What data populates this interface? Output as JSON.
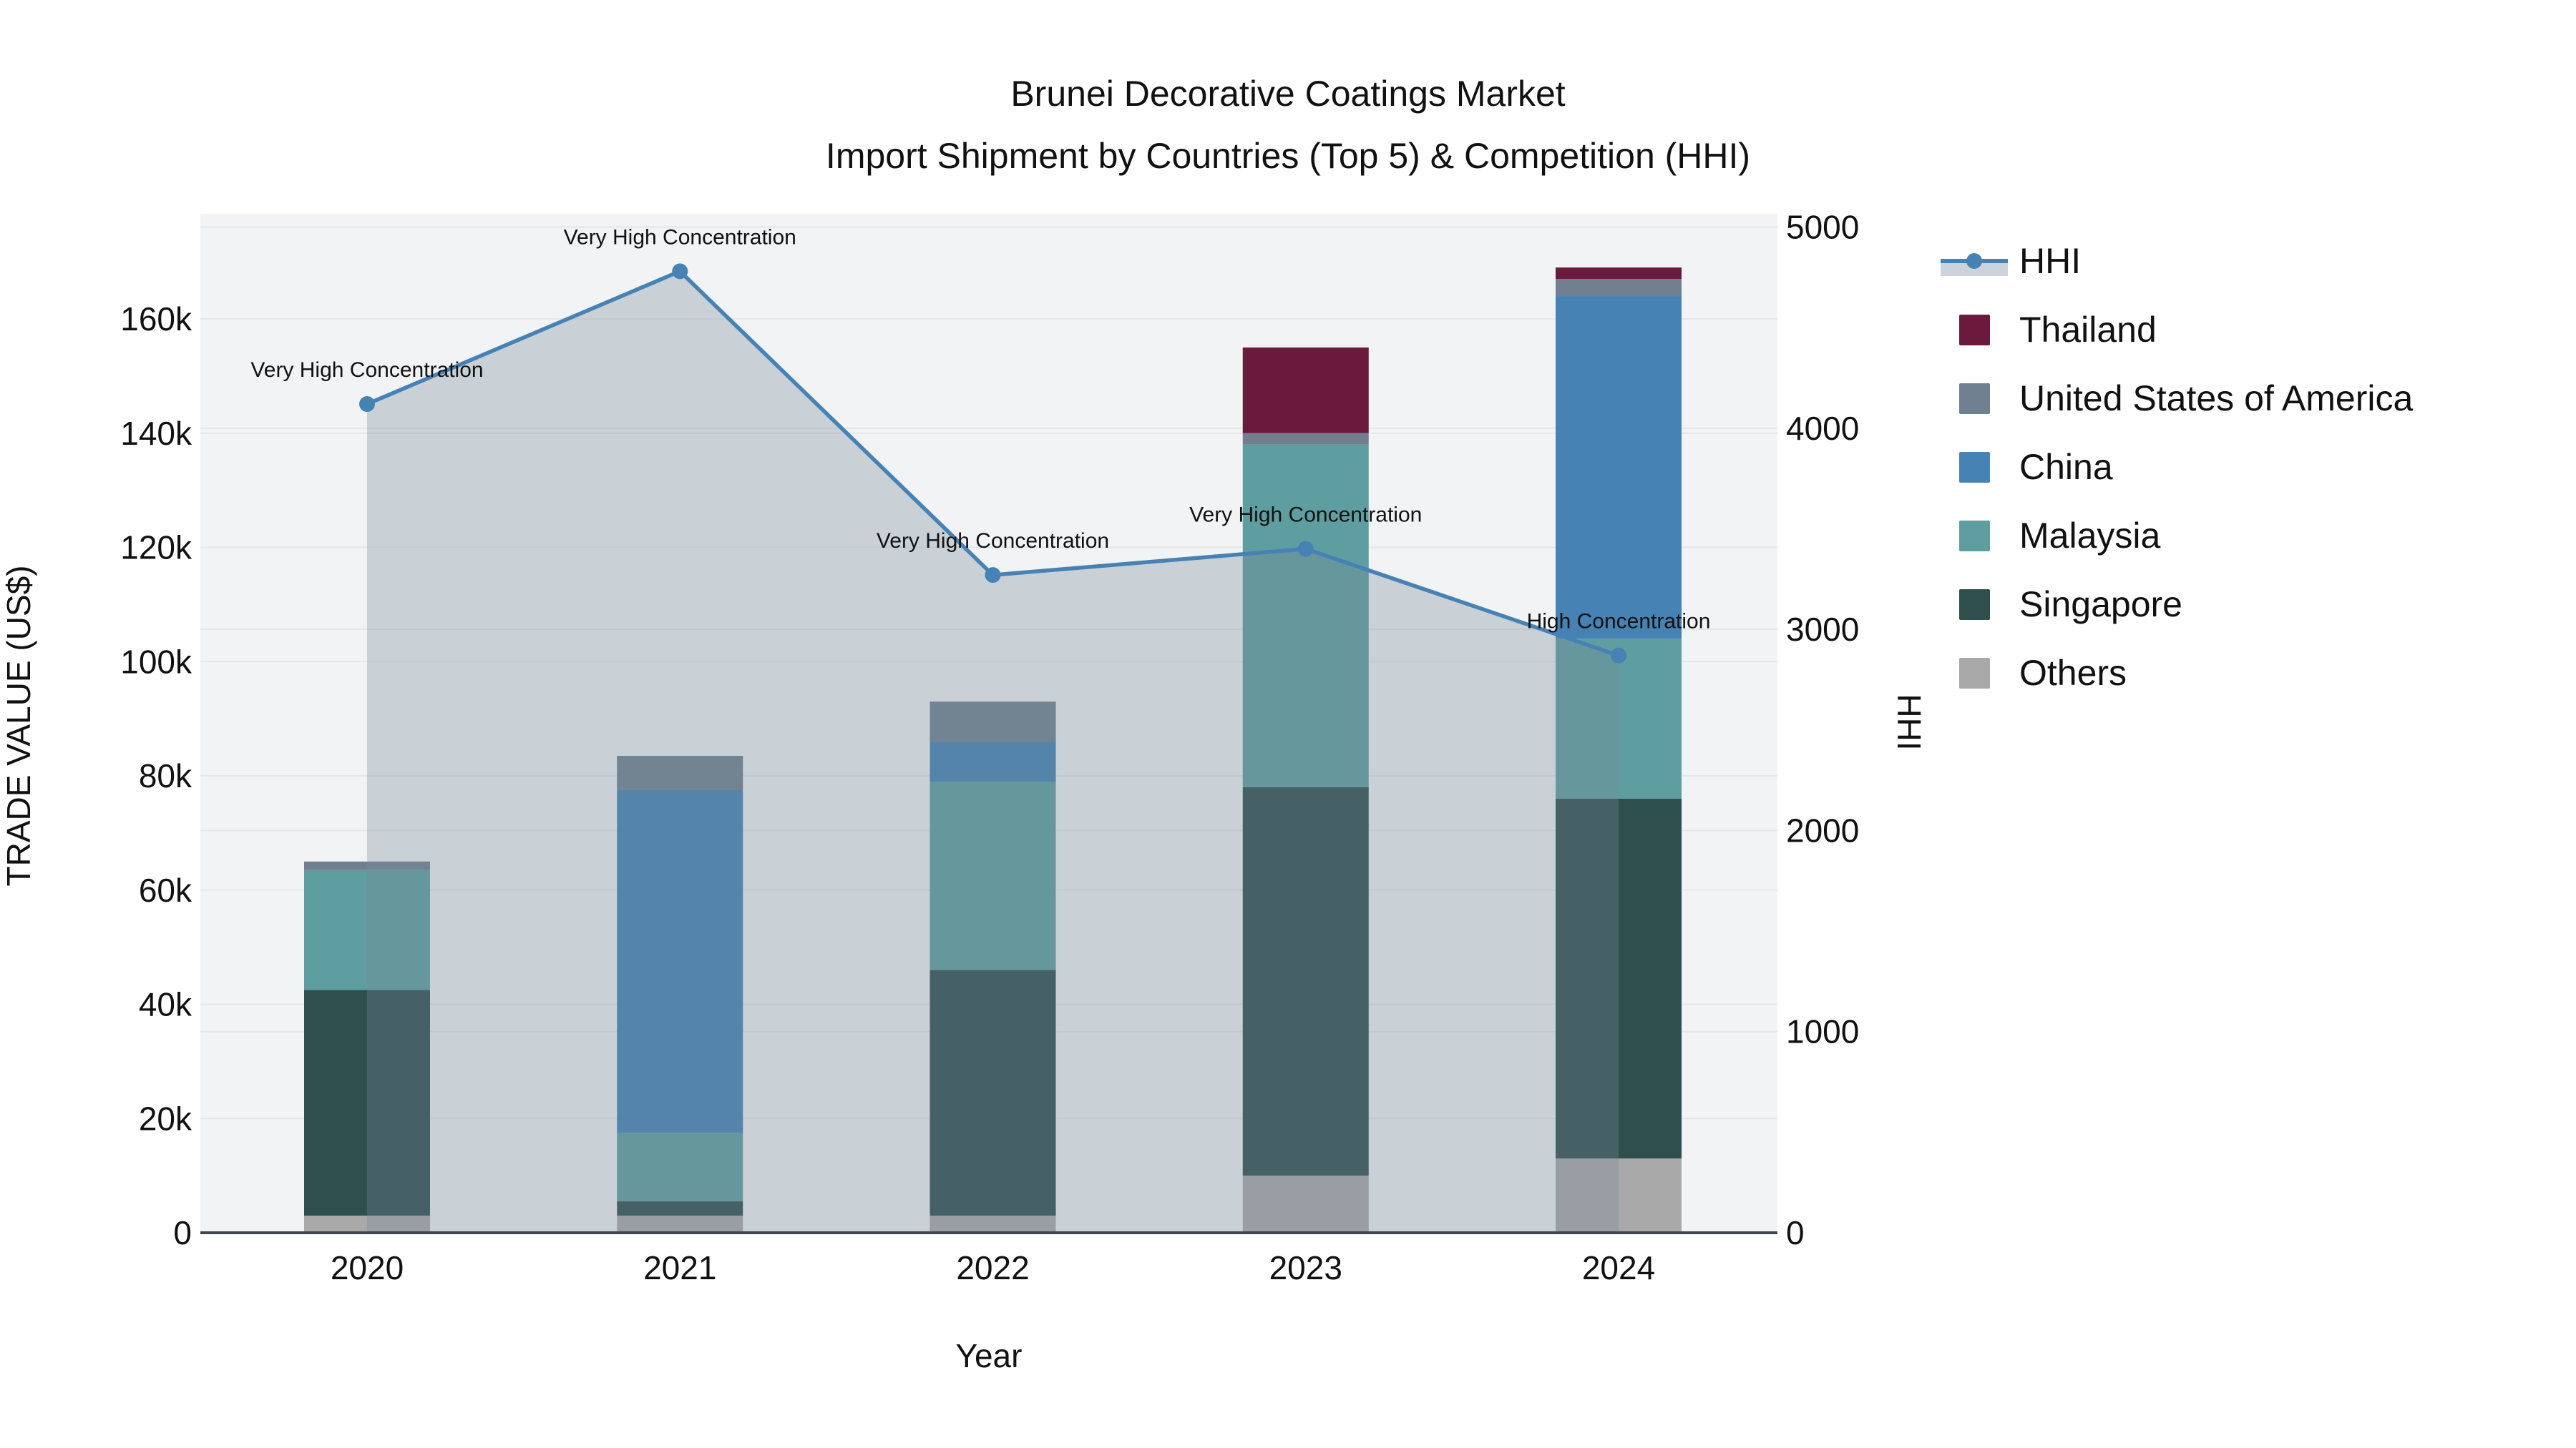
{
  "title": {
    "line1": "Brunei Decorative Coatings Market",
    "line2": "Import Shipment by Countries (Top 5) & Competition (HHI)"
  },
  "axes": {
    "x": {
      "title": "Year"
    },
    "y_left": {
      "title": "TRADE VALUE (US$)",
      "tick_labels": [
        "0",
        "20k",
        "40k",
        "60k",
        "80k",
        "100k",
        "120k",
        "140k",
        "160k"
      ],
      "tick_values": [
        0,
        20000,
        40000,
        60000,
        80000,
        100000,
        120000,
        140000,
        160000
      ]
    },
    "y_right": {
      "title": "HHI",
      "tick_labels": [
        "0",
        "1000",
        "2000",
        "3000",
        "4000",
        "5000"
      ],
      "tick_values": [
        0,
        1000,
        2000,
        3000,
        4000,
        5000
      ]
    }
  },
  "legend": {
    "items": [
      {
        "label": "HHI",
        "type": "line",
        "color": "#4682B4"
      },
      {
        "label": "Thailand",
        "type": "bar",
        "color": "#6A1B3D"
      },
      {
        "label": "United States of America",
        "type": "bar",
        "color": "#708090"
      },
      {
        "label": "China",
        "type": "bar",
        "color": "#4682B4"
      },
      {
        "label": "Malaysia",
        "type": "bar",
        "color": "#5F9EA0"
      },
      {
        "label": "Singapore",
        "type": "bar",
        "color": "#2F4F4F"
      },
      {
        "label": "Others",
        "type": "bar",
        "color": "#A9A9A9"
      }
    ]
  },
  "chart_data": {
    "type": "combo-stacked-bar-plus-line-area",
    "title": "Brunei Decorative Coatings Market Import Shipment by Countries (Top 5) & Competition (HHI)",
    "xlabel": "Year",
    "ylabel_left": "TRADE VALUE (US$)",
    "ylabel_right": "HHI",
    "ylim_left": [
      0,
      178000
    ],
    "ylim_right": [
      0,
      5000
    ],
    "grid": true,
    "legend_position": "right",
    "categories": [
      "2020",
      "2021",
      "2022",
      "2023",
      "2024"
    ],
    "bar_stack_order_bottom_to_top": [
      "Others",
      "Singapore",
      "Malaysia",
      "China",
      "United States of America",
      "Thailand"
    ],
    "series": [
      {
        "name": "Others",
        "color": "#A9A9A9",
        "values": [
          3000,
          3000,
          3000,
          10000,
          13000
        ]
      },
      {
        "name": "Singapore",
        "color": "#2F4F4F",
        "values": [
          39500,
          2500,
          43000,
          68000,
          63000
        ]
      },
      {
        "name": "Malaysia",
        "color": "#5F9EA0",
        "values": [
          21000,
          12000,
          33000,
          60000,
          28000
        ]
      },
      {
        "name": "China",
        "color": "#4682B4",
        "values": [
          0,
          60000,
          7000,
          0,
          60000
        ]
      },
      {
        "name": "United States of America",
        "color": "#708090",
        "values": [
          1500,
          6000,
          7000,
          2000,
          3000
        ]
      },
      {
        "name": "Thailand",
        "color": "#6A1B3D",
        "values": [
          0,
          0,
          0,
          15000,
          2000
        ]
      }
    ],
    "bar_totals": [
      65000,
      83500,
      93000,
      155000,
      169000
    ],
    "line": {
      "name": "HHI",
      "color": "#4682B4",
      "area_fill": "rgba(119,136,153,0.32)",
      "values": [
        4120,
        4780,
        3270,
        3400,
        2870
      ],
      "annotations": [
        "Very High Concentration",
        "Very High Concentration",
        "Very High Concentration",
        "Very High Concentration",
        "High Concentration"
      ]
    },
    "style_colors": {
      "plot_background": "#f2f3f4",
      "gridline": "#e5e6e8",
      "axis_line": "#42464a",
      "hhi_legend_band": "#ccd3dd"
    }
  }
}
